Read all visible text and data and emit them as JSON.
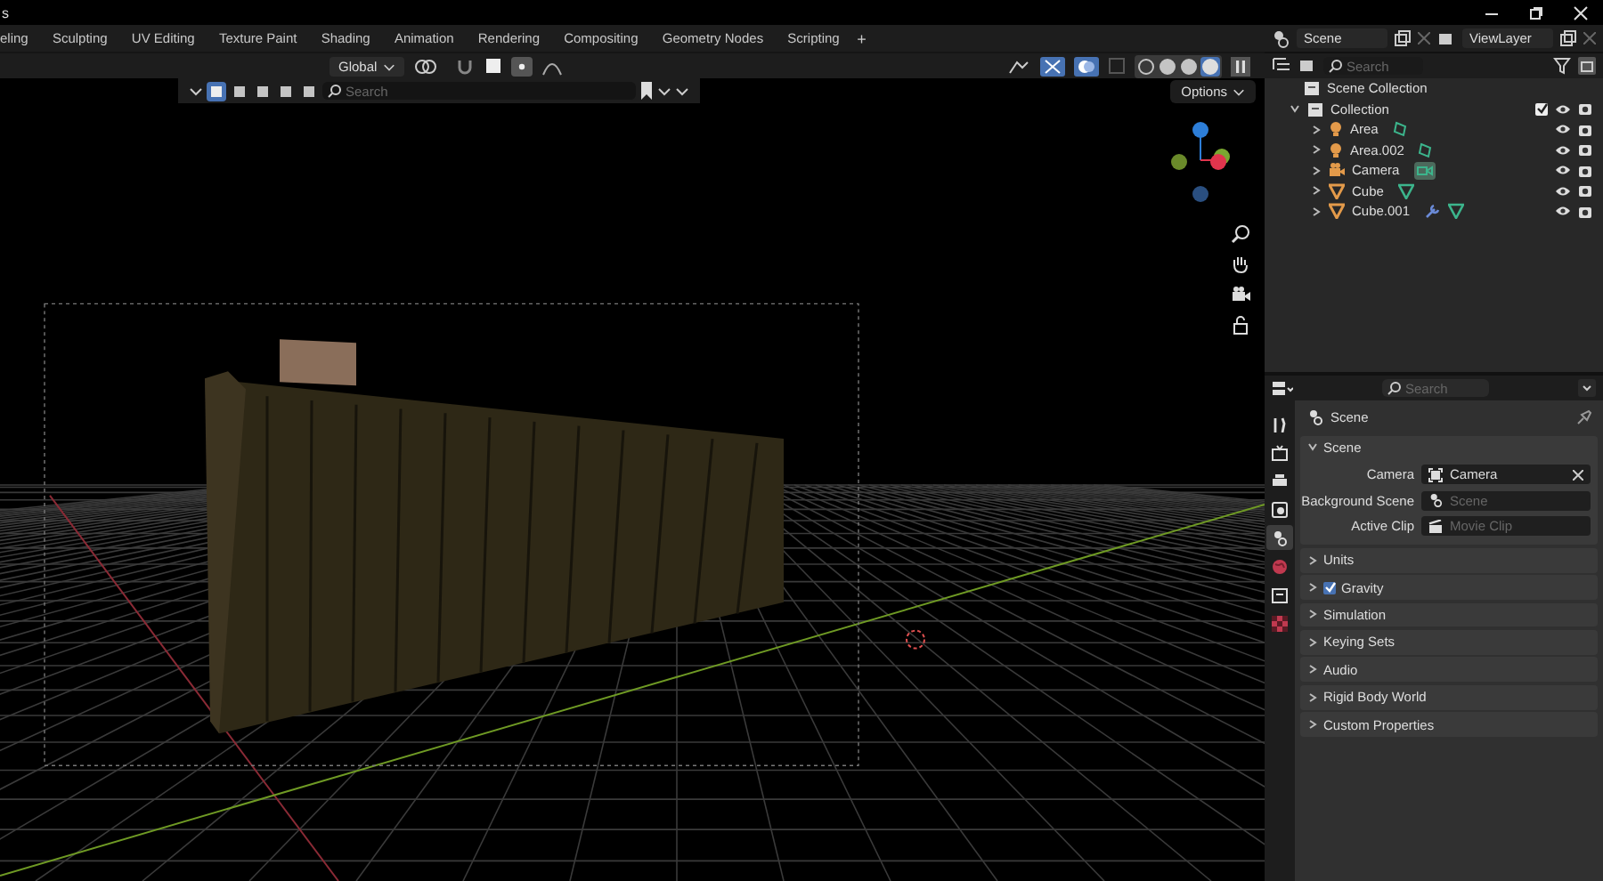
{
  "window": {
    "title": "s"
  },
  "workspace_tabs": [
    {
      "label": "eling",
      "selected": false
    },
    {
      "label": "Sculpting",
      "selected": false
    },
    {
      "label": "UV Editing",
      "selected": false
    },
    {
      "label": "Texture Paint",
      "selected": false
    },
    {
      "label": "Shading",
      "selected": false
    },
    {
      "label": "Animation",
      "selected": false
    },
    {
      "label": "Rendering",
      "selected": false
    },
    {
      "label": "Compositing",
      "selected": false
    },
    {
      "label": "Geometry Nodes",
      "selected": false
    },
    {
      "label": "Scripting",
      "selected": false
    }
  ],
  "add_workspace": "+",
  "scene_selector": {
    "value": "Scene"
  },
  "view_layer_selector": {
    "value": "ViewLayer"
  },
  "viewport_header": {
    "transform_orientation": "Global",
    "snap_on": false,
    "proportional_on": true,
    "select_modes": [
      {
        "selected": true
      },
      {
        "selected": false
      },
      {
        "selected": false
      },
      {
        "selected": false
      },
      {
        "selected": false
      }
    ],
    "search": {
      "placeholder": "Search"
    },
    "options": "Options",
    "shading_modes": [
      {
        "selected": false
      },
      {
        "selected": false
      },
      {
        "selected": false
      },
      {
        "selected": true
      }
    ]
  },
  "outliner": {
    "search": {
      "placeholder": "Search"
    },
    "scene_collection": "Scene Collection",
    "collection": {
      "label": "Collection",
      "checked": true,
      "expanded": true,
      "children": [
        {
          "label": "Area",
          "kind": "light",
          "expanded": false
        },
        {
          "label": "Area.002",
          "kind": "light",
          "expanded": false
        },
        {
          "label": "Camera",
          "kind": "camera",
          "expanded": false
        },
        {
          "label": "Cube",
          "kind": "mesh",
          "expanded": false
        },
        {
          "label": "Cube.001",
          "kind": "mesh_modified",
          "expanded": false
        }
      ]
    }
  },
  "properties": {
    "search": {
      "placeholder": "Search"
    },
    "context": "Scene",
    "tabs": [
      {
        "kind": "tool",
        "selected": false
      },
      {
        "kind": "render",
        "selected": false
      },
      {
        "kind": "output",
        "selected": false
      },
      {
        "kind": "view_layer",
        "selected": false
      },
      {
        "kind": "scene",
        "selected": true
      },
      {
        "kind": "world",
        "selected": false
      },
      {
        "kind": "collection",
        "selected": false
      },
      {
        "kind": "texture",
        "selected": false
      }
    ],
    "panels": [
      {
        "label": "Scene",
        "expanded": true,
        "fields": [
          {
            "label": "Camera",
            "value": "Camera",
            "kind": "camera"
          },
          {
            "label": "Background Scene",
            "placeholder": "Scene",
            "kind": "scene"
          },
          {
            "label": "Active Clip",
            "placeholder": "Movie Clip",
            "kind": "clip"
          }
        ]
      },
      {
        "label": "Units",
        "expanded": false
      },
      {
        "label": "Gravity",
        "expanded": false,
        "checked": true
      },
      {
        "label": "Simulation",
        "expanded": false
      },
      {
        "label": "Keying Sets",
        "expanded": false
      },
      {
        "label": "Audio",
        "expanded": false
      },
      {
        "label": "Rigid Body World",
        "expanded": false
      },
      {
        "label": "Custom Properties",
        "expanded": false
      }
    ]
  }
}
